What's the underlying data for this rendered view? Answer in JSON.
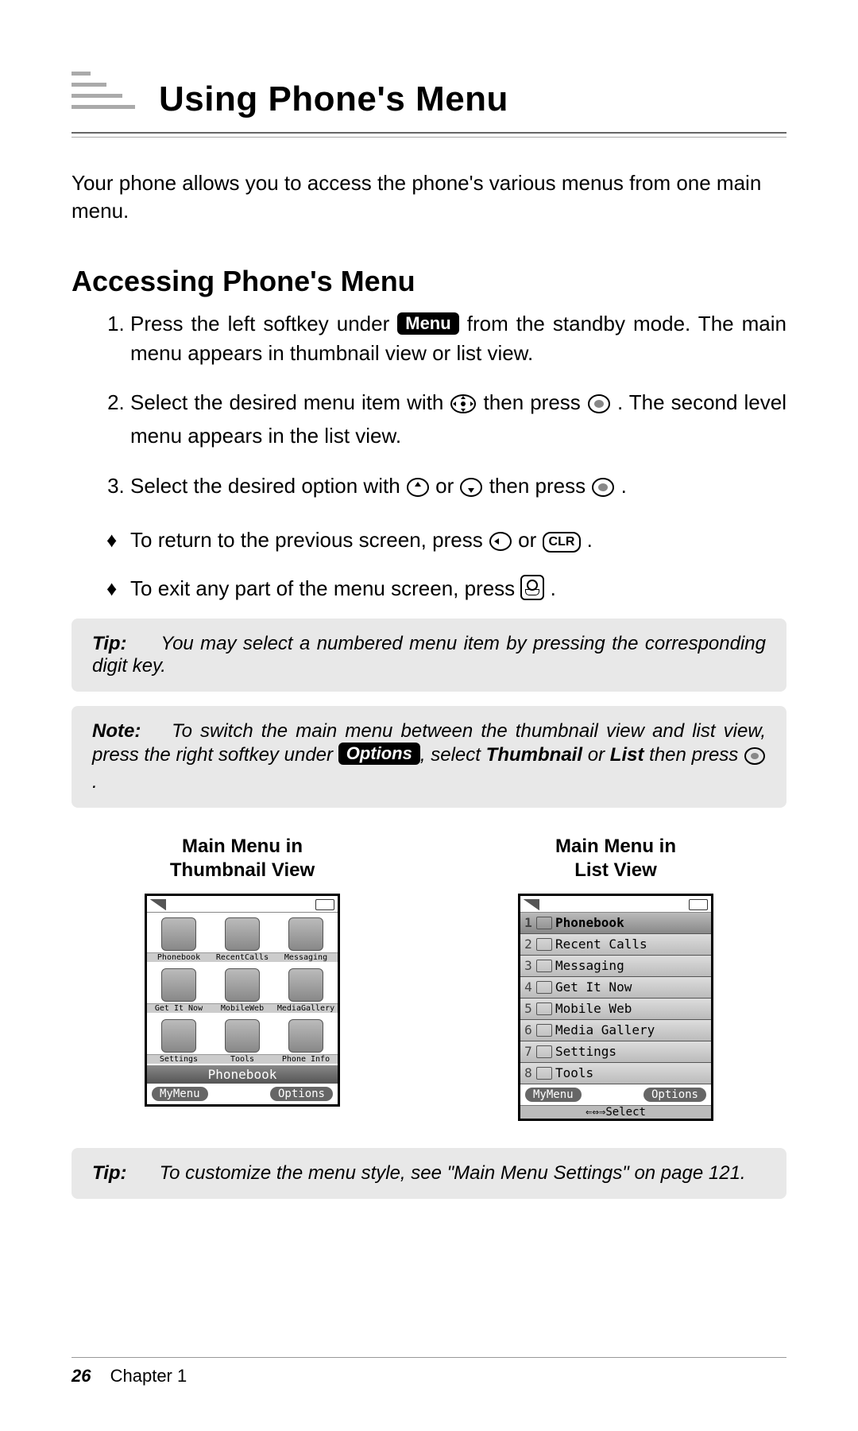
{
  "header": {
    "chapter_title": "Using Phone's Menu"
  },
  "intro": "Your phone allows you to access the phone's various menus from one main menu.",
  "section_heading": "Accessing Phone's Menu",
  "steps": {
    "s1a": "Press the left softkey under ",
    "s1_key": "Menu",
    "s1b": " from the standby mode. The main menu appears in thumbnail view or list view.",
    "s2a": "Select the desired menu item with ",
    "s2b": " then press ",
    "s2c": ". The second level menu appears in the list view.",
    "s3a": "Select the desired option with ",
    "s3b": " or ",
    "s3c": " then press ",
    "s3d": "."
  },
  "bullets": {
    "b1a": "To return to the previous screen, press ",
    "b1b": " or ",
    "b1_key": "CLR",
    "b1c": ".",
    "b2a": "To exit any part of the menu screen, press ",
    "b2b": "."
  },
  "tip1": {
    "label": "Tip:",
    "body": "You may select a numbered menu item by pressing the corresponding digit key."
  },
  "note": {
    "label": "Note:",
    "bodyA": "To switch the main menu between the thumbnail view and list view, press the right softkey under ",
    "key": "Options",
    "bodyB": ", select ",
    "strong1": "Thumbnail",
    "bodyC": " or ",
    "strong2": "List",
    "bodyD": " then press ",
    "bodyE": " ."
  },
  "shots": {
    "captionThumbA": "Main Menu in",
    "captionThumbB": "Thumbnail View",
    "captionListA": "Main Menu in",
    "captionListB": "List View",
    "thumb_items": [
      "Phonebook",
      "RecentCalls",
      "Messaging",
      "Get It Now",
      "MobileWeb",
      "MediaGallery",
      "Settings",
      "Tools",
      "Phone Info"
    ],
    "thumb_focus": "Phonebook",
    "softkey_left": "MyMenu",
    "softkey_right": "Options",
    "list_items": [
      {
        "n": "1",
        "t": "Phonebook"
      },
      {
        "n": "2",
        "t": "Recent Calls"
      },
      {
        "n": "3",
        "t": "Messaging"
      },
      {
        "n": "4",
        "t": "Get It Now"
      },
      {
        "n": "5",
        "t": "Mobile Web"
      },
      {
        "n": "6",
        "t": "Media Gallery"
      },
      {
        "n": "7",
        "t": "Settings"
      },
      {
        "n": "8",
        "t": "Tools"
      }
    ],
    "select_label": "Select"
  },
  "tip2": {
    "label": "Tip:",
    "body": "To customize the menu style, see \"Main Menu Settings\" on page 121."
  },
  "footer": {
    "page_number": "26",
    "chapter": "Chapter 1"
  }
}
